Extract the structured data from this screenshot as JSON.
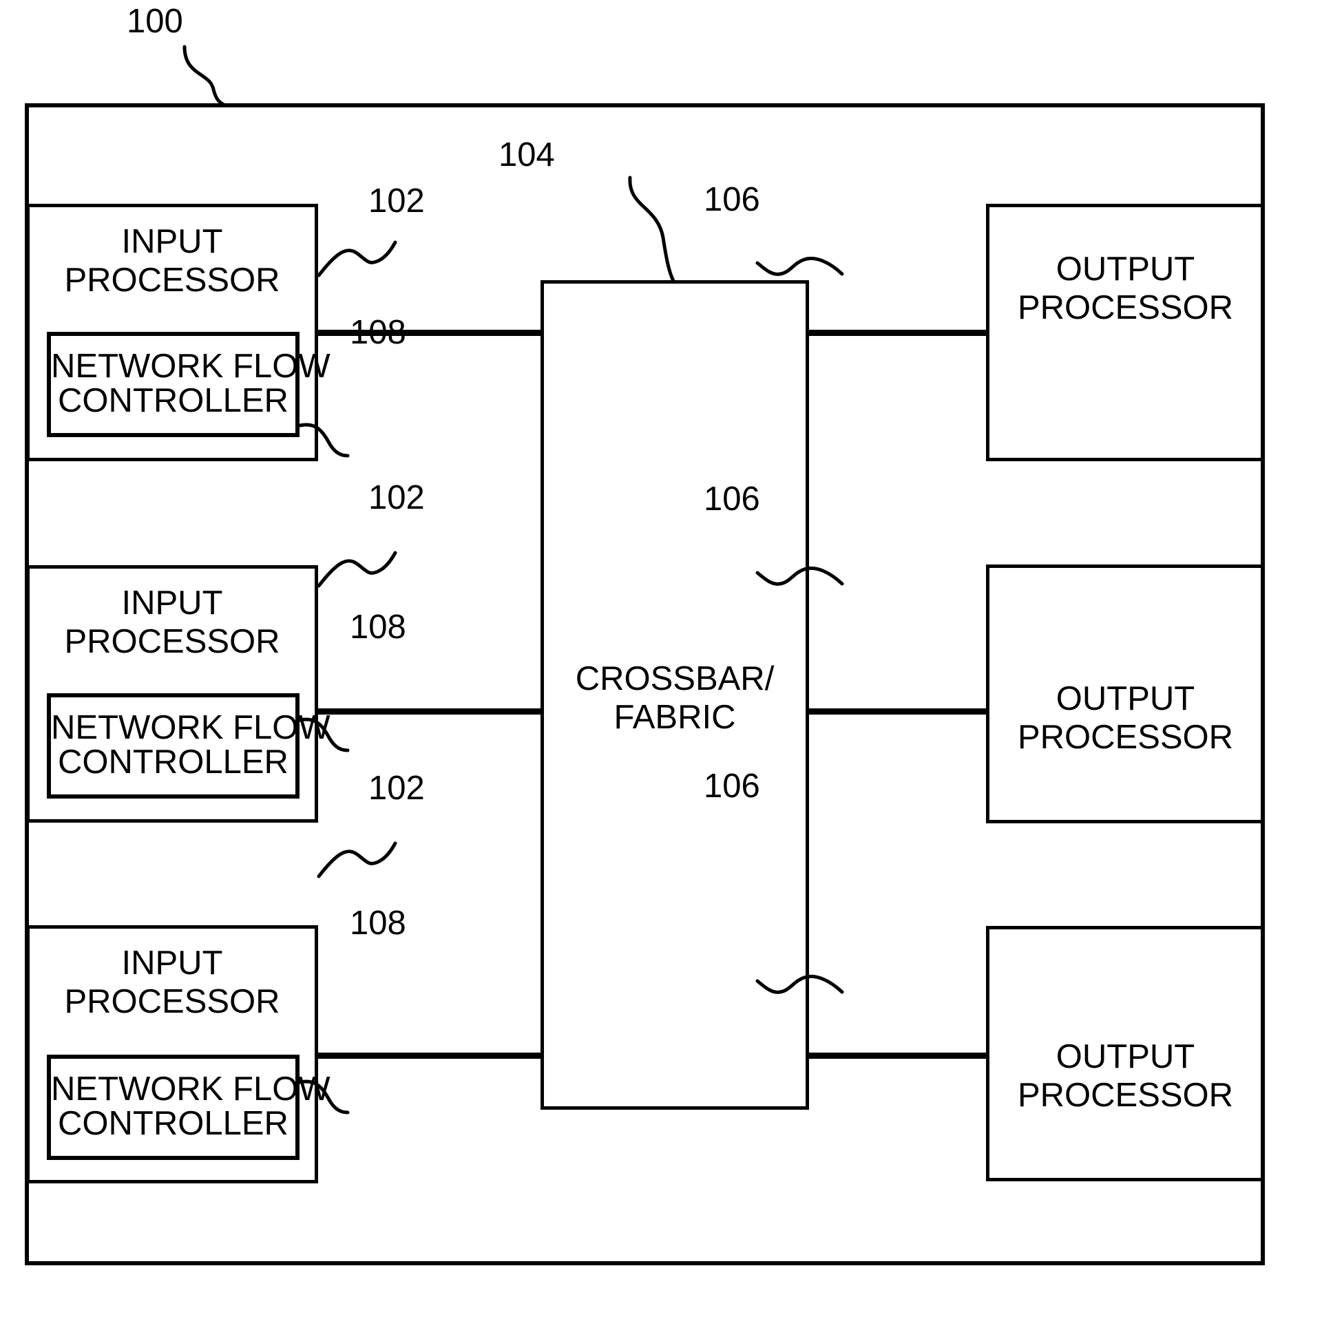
{
  "figure": {
    "background_color": "#ffffff",
    "line_color": "#000000",
    "title_ref": "100"
  },
  "reference_numerals": {
    "system": "100",
    "input_processor": "102",
    "crossbar": "104",
    "output_processor": "106",
    "network_flow_controller": "108"
  },
  "blocks": {
    "system_label": "100",
    "crossbar": {
      "label_line1": "CROSSBAR/",
      "label_line2": "FABRIC",
      "ref": "104"
    },
    "input_processors": [
      {
        "label_line1": "INPUT",
        "label_line2": "PROCESSOR",
        "ref": "102",
        "controller": {
          "label_line1": "NETWORK FLOW",
          "label_line2": "CONTROLLER",
          "ref": "108"
        }
      },
      {
        "label_line1": "INPUT",
        "label_line2": "PROCESSOR",
        "ref": "102",
        "controller": {
          "label_line1": "NETWORK FLOW",
          "label_line2": "CONTROLLER",
          "ref": "108"
        }
      },
      {
        "label_line1": "INPUT",
        "label_line2": "PROCESSOR",
        "ref": "102",
        "controller": {
          "label_line1": "NETWORK FLOW",
          "label_line2": "CONTROLLER",
          "ref": "108"
        }
      }
    ],
    "output_processors": [
      {
        "label_line1": "OUTPUT",
        "label_line2": "PROCESSOR",
        "ref": "106"
      },
      {
        "label_line1": "OUTPUT",
        "label_line2": "PROCESSOR",
        "ref": "106"
      },
      {
        "label_line1": "OUTPUT",
        "label_line2": "PROCESSOR",
        "ref": "106"
      }
    ]
  }
}
